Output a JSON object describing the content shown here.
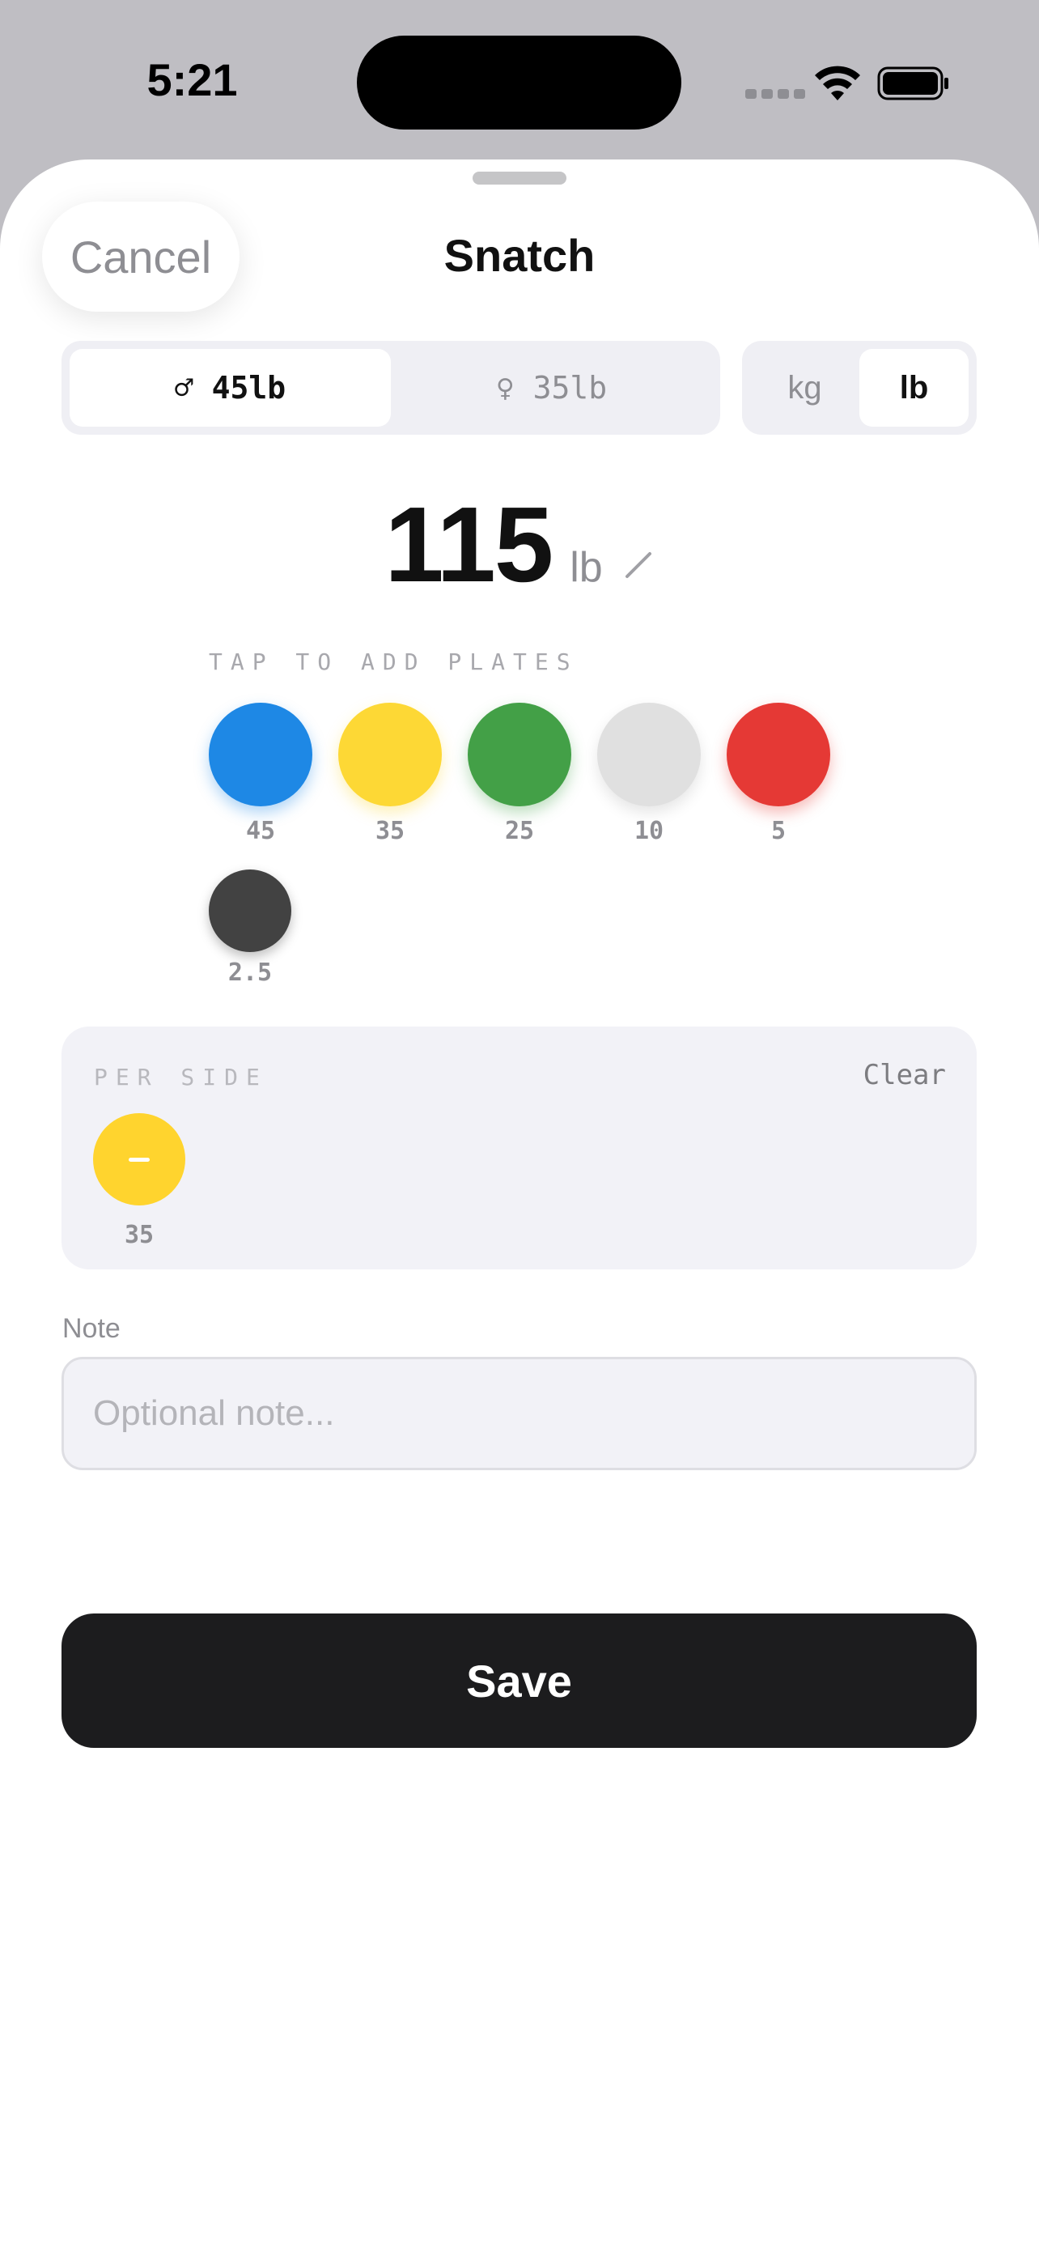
{
  "status_bar": {
    "time": "5:21"
  },
  "header": {
    "cancel_label": "Cancel",
    "title": "Snatch"
  },
  "bar_selector": {
    "options": [
      {
        "label": "♂ 45lb",
        "active": true
      },
      {
        "label": "♀ 35lb",
        "active": false
      }
    ]
  },
  "unit_selector": {
    "options": [
      {
        "label": "kg",
        "active": false
      },
      {
        "label": "lb",
        "active": true
      }
    ]
  },
  "weight": {
    "value": "115",
    "unit": "lb"
  },
  "plates": {
    "label": "TAP TO ADD PLATES",
    "items": [
      {
        "value": "45",
        "color": "#1e88e5"
      },
      {
        "value": "35",
        "color": "#fdd835"
      },
      {
        "value": "25",
        "color": "#43a047"
      },
      {
        "value": "10",
        "color": "#e0e0e0"
      },
      {
        "value": "5",
        "color": "#e53935"
      },
      {
        "value": "2.5",
        "color": "#424242"
      }
    ]
  },
  "per_side": {
    "label": "PER SIDE",
    "clear_label": "Clear",
    "plates": [
      {
        "value": "35",
        "color": "#ffd42e"
      }
    ]
  },
  "note": {
    "label": "Note",
    "placeholder": "Optional note...",
    "value": ""
  },
  "save_label": "Save"
}
